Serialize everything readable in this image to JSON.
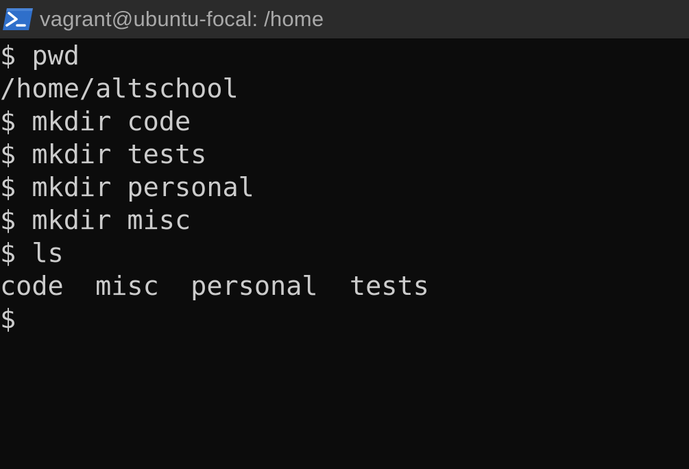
{
  "window": {
    "title": "vagrant@ubuntu-focal: /home",
    "icon": "powershell-icon"
  },
  "colors": {
    "terminal_background": "#0c0c0c",
    "titlebar_background": "#2b2b2b",
    "text": "#cccccc",
    "title_text": "#a9a9a9",
    "icon_accent": "#2f6fca"
  },
  "terminal": {
    "lines": [
      "$ pwd",
      "/home/altschool",
      "$ mkdir code",
      "$ mkdir tests",
      "$ mkdir personal",
      "$ mkdir misc",
      "$ ls",
      "code  misc  personal  tests",
      "$"
    ]
  }
}
